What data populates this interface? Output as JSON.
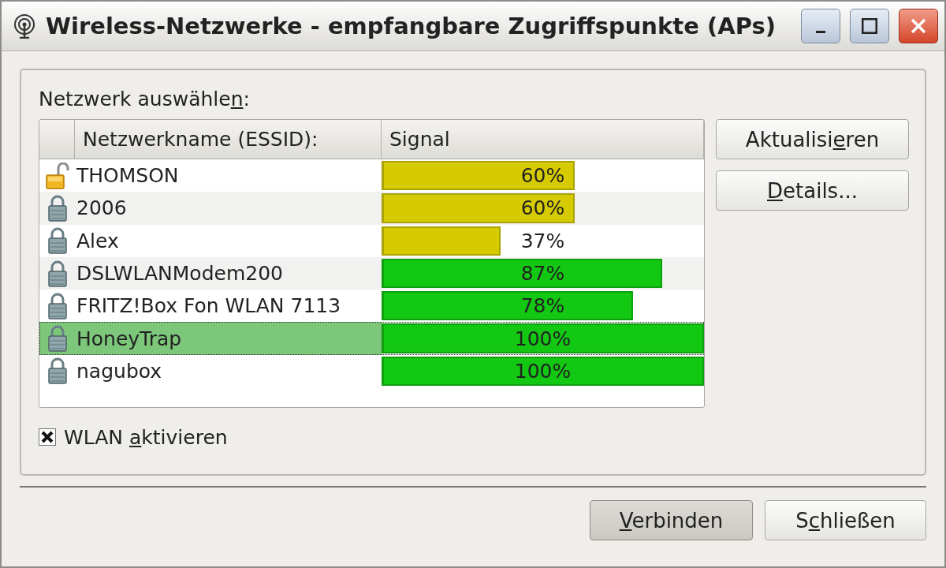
{
  "window": {
    "title": "Wireless-Netzwerke - empfangbare Zugriffspunkte (APs)"
  },
  "network_group": {
    "label": {
      "before": "Netzwerk auswähle",
      "key": "n",
      "after": ":"
    },
    "columns": [
      "Netzwerkname (ESSID):",
      "Signal"
    ],
    "networks": [
      {
        "name": "THOMSON",
        "locked": false,
        "reading": "60%",
        "color": "#d6cb00",
        "selected": false
      },
      {
        "name": "2006",
        "locked": true,
        "reading": "60%",
        "color": "#d6cb00",
        "selected": false
      },
      {
        "name": "Alex",
        "locked": true,
        "reading": "37%",
        "color": "#d6cb00",
        "selected": false
      },
      {
        "name": "DSLWLANModem200",
        "locked": true,
        "reading": "87%",
        "color": "#12c812",
        "selected": false
      },
      {
        "name": "FRITZ!Box Fon WLAN 7113",
        "locked": true,
        "reading": "78%",
        "color": "#12c812",
        "selected": false
      },
      {
        "name": "HoneyTrap",
        "locked": true,
        "reading": "100%",
        "color": "#12c812",
        "selected": true
      },
      {
        "name": "nagubox",
        "locked": true,
        "reading": "100%",
        "color": "#12c812",
        "selected": false
      }
    ],
    "side_buttons": [
      {
        "before": "Aktualisi",
        "key": "e",
        "after": "ren"
      },
      {
        "key": "D",
        "after": "etails..."
      }
    ],
    "wlan_checkbox": {
      "label": {
        "before": "WLAN ",
        "key": "a",
        "after": "ktivieren"
      },
      "checked": true
    }
  },
  "buttons": [
    {
      "label": {
        "key": "V",
        "after": "erbinden"
      },
      "default": true
    },
    {
      "label": {
        "before": "S",
        "key": "c",
        "after": "hließen"
      },
      "default": false
    }
  ]
}
